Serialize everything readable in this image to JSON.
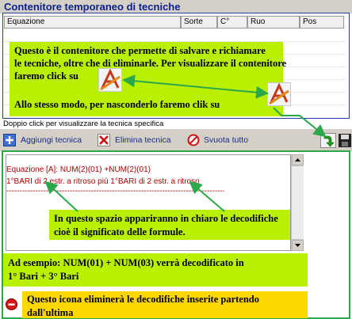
{
  "window": {
    "title": "Contenitore temporaneo di tecniche"
  },
  "table": {
    "columns": [
      "Equazione",
      "Sorte",
      "C°",
      "Ruo",
      "Pos"
    ]
  },
  "callouts": {
    "container": {
      "line1": "Questo è il contenitore che permette di salvare e richiamare",
      "line2": "le tecniche, oltre che di eliminarle. Per visualizzare il contenitore",
      "line3": "faremo click su",
      "line4": "Allo stesso modo, per nasconderlo  faremo clik su"
    },
    "space": {
      "line1": "In questo spazio appariranno in chiaro le decodifiche",
      "line2": "cioè il significato delle formule."
    },
    "example": {
      "line1": "Ad esempio: NUM(01) + NUM(03) verrà decodificato in",
      "line2": "1° Bari + 3° Bari"
    },
    "delete": {
      "line1": "Questo icona eliminerà le decodifiche inserite partendo",
      "line2": "dall'ultima"
    }
  },
  "hint": "Doppio click per visualizzare la tecnica specifica",
  "toolbar": {
    "add_label": "Aggiungi tecnica",
    "delete_label": "Elimina tecnica",
    "clear_label": "Svuota tutto"
  },
  "decode": {
    "line1": "Equazione [A]: NUM(2)(01) +NUM(2)(01)",
    "line2": "1°BARI di 2 estr. a ritroso più  1°BARI  di 2 estr. a ritroso",
    "line3": "------------------------------------------------------------------------------------------------------"
  },
  "colors": {
    "frame": "#1f3fa8",
    "title_text": "#0a1e8c",
    "callout": "#b8f000",
    "delete_callout": "#ffd700",
    "decode_text": "#b00000",
    "arrow": "#2aa84a"
  },
  "icons": {
    "show_container": "drafting-tools-icon",
    "hide_container": "drafting-tools-icon",
    "add": "plus-icon",
    "delete": "red-x-icon",
    "clear": "no-entry-icon",
    "green_arrow": "green-arrow-icon",
    "save": "floppy-disk-icon",
    "delete_decode": "stop-icon"
  }
}
